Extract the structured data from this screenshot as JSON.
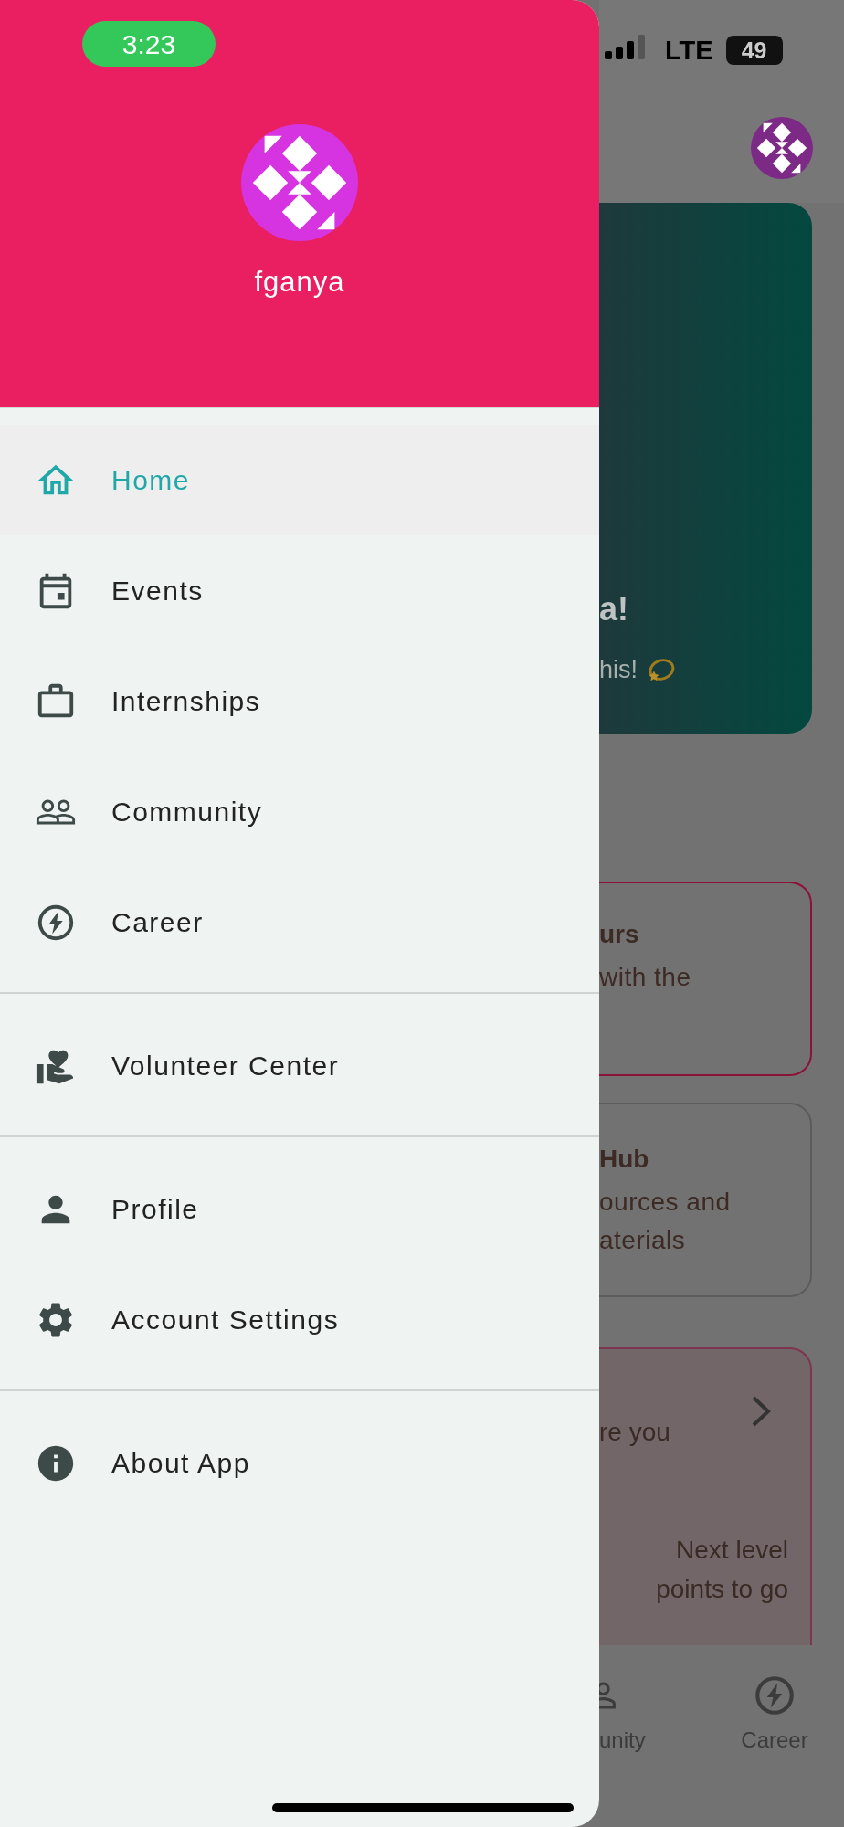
{
  "status_bar": {
    "time": "3:23",
    "network": "LTE",
    "battery": "49"
  },
  "drawer": {
    "username": "fganya",
    "sections": [
      {
        "items": [
          {
            "label": "Home",
            "kind": "home",
            "selected": true
          },
          {
            "label": "Events",
            "kind": "calendar",
            "selected": false
          },
          {
            "label": "Internships",
            "kind": "briefcase",
            "selected": false
          },
          {
            "label": "Community",
            "kind": "people",
            "selected": false
          },
          {
            "label": "Career",
            "kind": "bolt",
            "selected": false
          }
        ]
      },
      {
        "items": [
          {
            "label": "Volunteer Center",
            "kind": "volunteer",
            "selected": false
          }
        ]
      },
      {
        "items": [
          {
            "label": "Profile",
            "kind": "person",
            "selected": false
          },
          {
            "label": "Account Settings",
            "kind": "gear",
            "selected": false
          }
        ]
      },
      {
        "items": [
          {
            "label": "About App",
            "kind": "info",
            "selected": false
          }
        ]
      }
    ]
  },
  "background": {
    "hero": {
      "title": "a!",
      "subtitle": "his!"
    },
    "cards": [
      {
        "kind": "accent",
        "title": "urs",
        "lines": [
          "with the"
        ]
      },
      {
        "kind": "plain",
        "title": "Hub",
        "lines": [
          "ources and",
          "aterials"
        ]
      }
    ],
    "progress_card": {
      "text": "re you",
      "next_label": "Next level",
      "points": "points to go"
    },
    "bottom_nav": [
      {
        "label": "unity",
        "kind": "people"
      },
      {
        "label": "Career",
        "kind": "bolt"
      }
    ]
  }
}
